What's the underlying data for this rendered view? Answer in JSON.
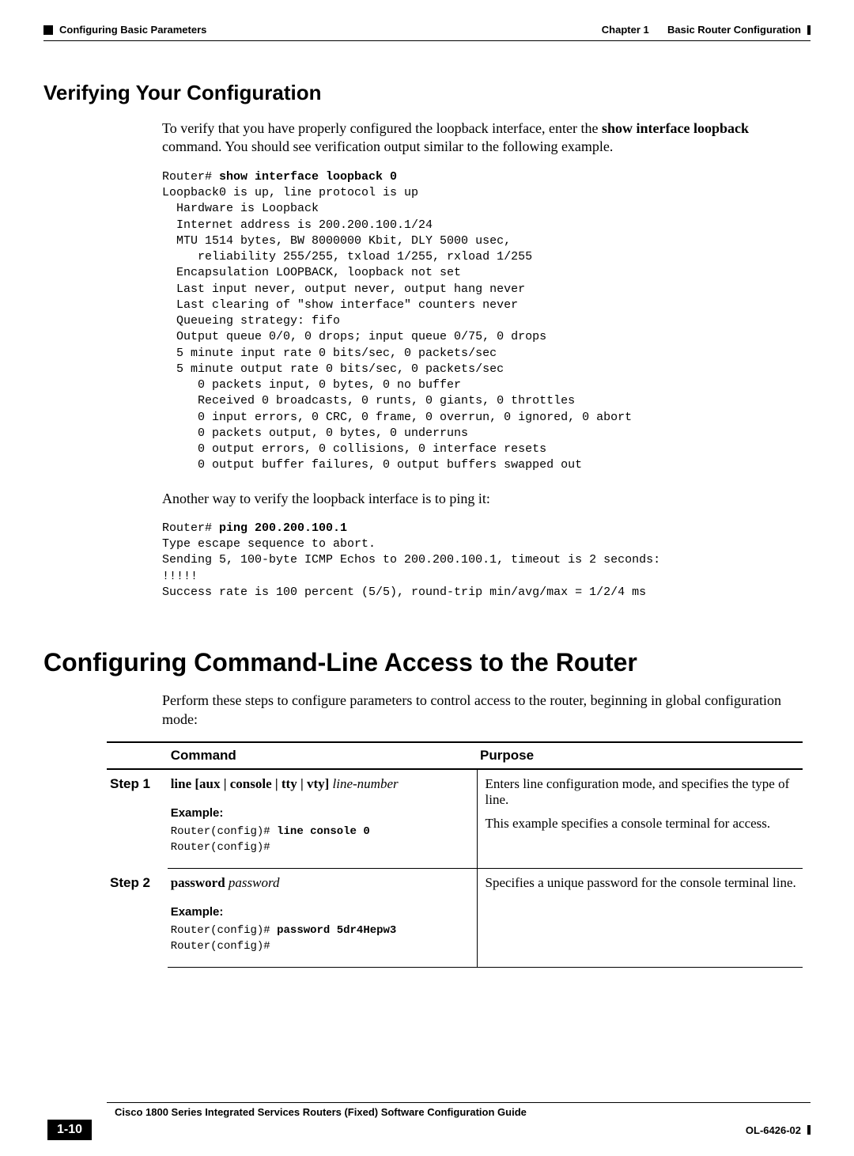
{
  "header": {
    "left": "Configuring Basic Parameters",
    "right_prefix": "Chapter 1",
    "right_title": "Basic Router Configuration"
  },
  "section_verify": {
    "title": "Verifying Your Configuration",
    "intro_pre": "To verify that you have properly configured the loopback interface, enter the ",
    "intro_cmd": "show interface loopback",
    "intro_post": " command. You should see verification output similar to the following example.",
    "cli1_prompt": "Router# ",
    "cli1_cmd": "show interface loopback 0",
    "cli1_body": "Loopback0 is up, line protocol is up\n  Hardware is Loopback\n  Internet address is 200.200.100.1/24\n  MTU 1514 bytes, BW 8000000 Kbit, DLY 5000 usec,\n     reliability 255/255, txload 1/255, rxload 1/255\n  Encapsulation LOOPBACK, loopback not set\n  Last input never, output never, output hang never\n  Last clearing of \"show interface\" counters never\n  Queueing strategy: fifo\n  Output queue 0/0, 0 drops; input queue 0/75, 0 drops\n  5 minute input rate 0 bits/sec, 0 packets/sec\n  5 minute output rate 0 bits/sec, 0 packets/sec\n     0 packets input, 0 bytes, 0 no buffer\n     Received 0 broadcasts, 0 runts, 0 giants, 0 throttles\n     0 input errors, 0 CRC, 0 frame, 0 overrun, 0 ignored, 0 abort\n     0 packets output, 0 bytes, 0 underruns\n     0 output errors, 0 collisions, 0 interface resets\n     0 output buffer failures, 0 output buffers swapped out",
    "mid_para": "Another way to verify the loopback interface is to ping it:",
    "cli2_prompt": "Router# ",
    "cli2_cmd": "ping 200.200.100.1",
    "cli2_body": "Type escape sequence to abort.\nSending 5, 100-byte ICMP Echos to 200.200.100.1, timeout is 2 seconds:\n!!!!!\nSuccess rate is 100 percent (5/5), round-trip min/avg/max = 1/2/4 ms"
  },
  "section_cli": {
    "title": "Configuring Command-Line Access to the Router",
    "intro": "Perform these steps to configure parameters to control access to the router, beginning in global configuration mode:",
    "headers": {
      "command": "Command",
      "purpose": "Purpose"
    },
    "rows": [
      {
        "step": "Step 1",
        "syntax_bold": "line",
        "syntax_options": " [aux | console | tty | vty] ",
        "syntax_arg": "line-number",
        "example_label": "Example:",
        "example_prompt": "Router(config)# ",
        "example_cmd": "line console 0",
        "example_after": "Router(config)#",
        "purpose1": "Enters line configuration mode, and specifies the type of line.",
        "purpose2": "This example specifies a console terminal for access."
      },
      {
        "step": "Step 2",
        "syntax_bold": "password",
        "syntax_options": " ",
        "syntax_arg": "password",
        "example_label": "Example:",
        "example_prompt": "Router(config)# ",
        "example_cmd": "password 5dr4Hepw3",
        "example_after": "Router(config)#",
        "purpose1": "Specifies a unique password for the console terminal line.",
        "purpose2": ""
      }
    ]
  },
  "footer": {
    "guide_title": "Cisco 1800 Series Integrated Services Routers (Fixed) Software Configuration Guide",
    "page_num": "1-10",
    "doc_num": "OL-6426-02"
  }
}
